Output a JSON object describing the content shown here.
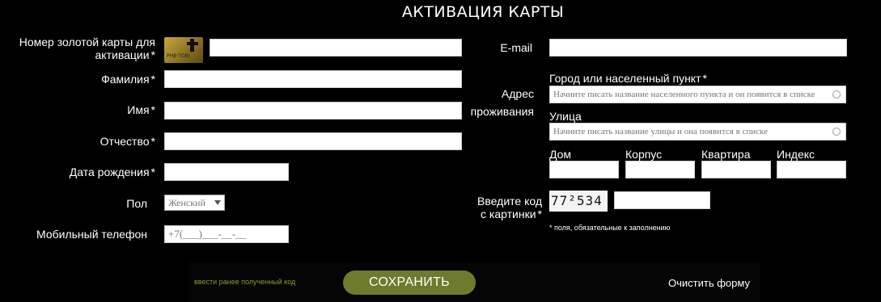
{
  "title": "АКТИВАЦИЯ КАРТЫ",
  "left": {
    "card_number_label_line1": "Номер золотой карты для",
    "card_number_label_line2": "активации",
    "surname_label": "Фамилия",
    "name_label": "Имя",
    "patronymic_label": "Отчество",
    "birthdate_label": "Дата рождения",
    "gender_label": "Пол",
    "gender_value": "Женский",
    "phone_label": "Мобильный телефон",
    "phone_value": "+7(___)___-__-__"
  },
  "right": {
    "email_label": "E-mail",
    "address_label_line1": "Адрес",
    "address_label_line2": "проживания",
    "city_label": "Город или населенный пункт",
    "city_placeholder": "Начните писать название населенного пункта и он появится в списке",
    "street_label": "Улица",
    "street_placeholder": "Начните писать название улицы и она появится в списке",
    "house_label": "Дом",
    "building_label": "Корпус",
    "apartment_label": "Квартира",
    "index_label": "Индекс",
    "captcha_label_line1": "Введите код",
    "captcha_label_line2": "с картинки",
    "captcha_text": "77²534",
    "required_note": "* поля, обязательные к заполнению"
  },
  "card_icon_text": "PHB·TOBI",
  "required_mark": "*",
  "footer": {
    "prev_code_link": "ввести ранее полученный код",
    "save_button": "СОХРАНИТЬ",
    "clear_button": "Очистить форму"
  },
  "colors": {
    "background": "#000000",
    "accent": "#6e7a2c",
    "link": "#8e9a36"
  },
  "icons": [
    "gold-card-icon",
    "circle-icon",
    "dropdown-arrow-icon",
    "captcha-image"
  ]
}
